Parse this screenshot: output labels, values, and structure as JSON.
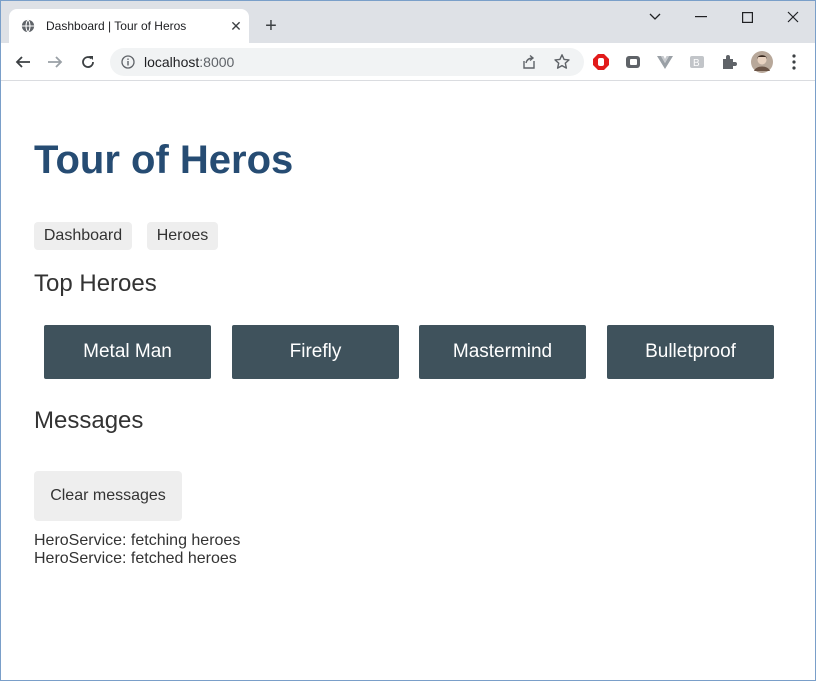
{
  "browser": {
    "tab_title": "Dashboard | Tour of Heros",
    "url_host": "localhost",
    "url_port": ":8000",
    "icons": [
      "globe-icon",
      "close-icon",
      "plus-icon",
      "minimize-icon",
      "maximize-icon",
      "close-window-icon",
      "back-icon",
      "forward-icon",
      "reload-icon",
      "info-icon",
      "share-icon",
      "star-icon",
      "extensions"
    ]
  },
  "app": {
    "title": "Tour of Heros",
    "nav": {
      "dashboard": "Dashboard",
      "heroes": "Heroes"
    },
    "top_heroes_title": "Top Heroes",
    "heroes": [
      "Metal Man",
      "Firefly",
      "Mastermind",
      "Bulletproof"
    ],
    "messages_title": "Messages",
    "clear_label": "Clear messages",
    "messages": [
      "HeroService: fetching heroes",
      "HeroService: fetched heroes"
    ]
  },
  "colors": {
    "title": "#264c73",
    "hero_card": "#3f525c",
    "button_bg": "#eeeeee",
    "tab_bar": "#dee1e6"
  }
}
